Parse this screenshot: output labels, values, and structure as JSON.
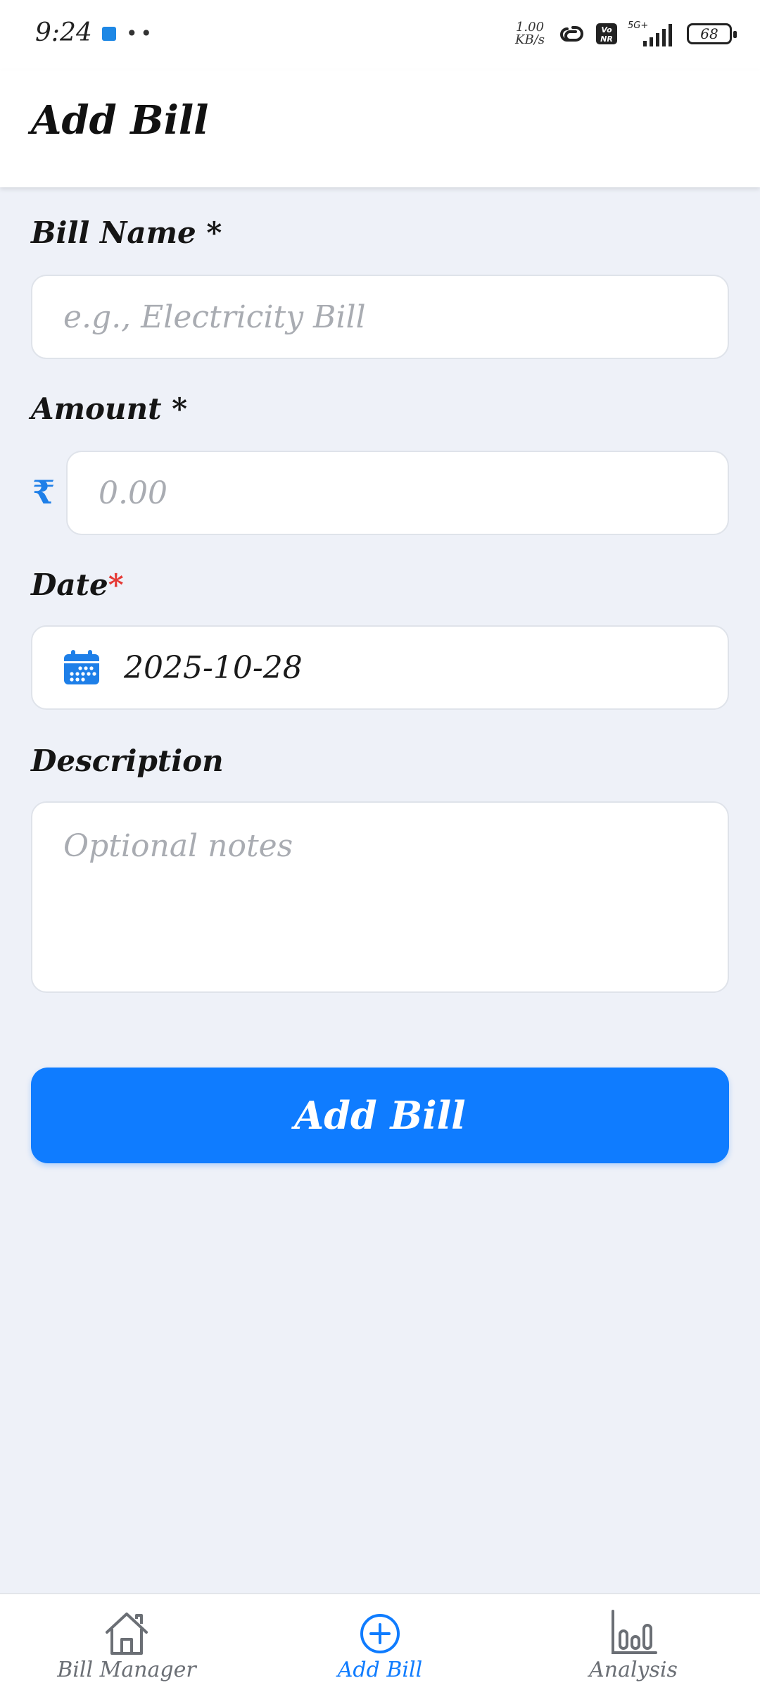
{
  "status_bar": {
    "time": "9:24",
    "net_speed_value": "1.00",
    "net_speed_unit": "KB/s",
    "network": "5G+",
    "volte": "Vo NR",
    "battery": "68"
  },
  "header": {
    "title": "Add Bill"
  },
  "form": {
    "bill_name": {
      "label": "Bill Name *",
      "placeholder": "e.g., Electricity Bill",
      "value": ""
    },
    "amount": {
      "label": "Amount *",
      "currency_symbol": "₹",
      "placeholder": "0.00",
      "value": ""
    },
    "date": {
      "label": "Date",
      "required_mark": "*",
      "value": "2025-10-28",
      "icon": "calendar-icon"
    },
    "description": {
      "label": "Description",
      "placeholder": "Optional notes",
      "value": ""
    },
    "submit_label": "Add Bill"
  },
  "bottom_nav": {
    "items": [
      {
        "label": "Bill Manager",
        "icon": "home-icon",
        "active": false
      },
      {
        "label": "Add Bill",
        "icon": "plus-circle-icon",
        "active": true
      },
      {
        "label": "Analysis",
        "icon": "bar-chart-icon",
        "active": false
      }
    ]
  },
  "colors": {
    "accent": "#0f7cff",
    "background": "#eef1f8",
    "required_red": "#e53935"
  }
}
